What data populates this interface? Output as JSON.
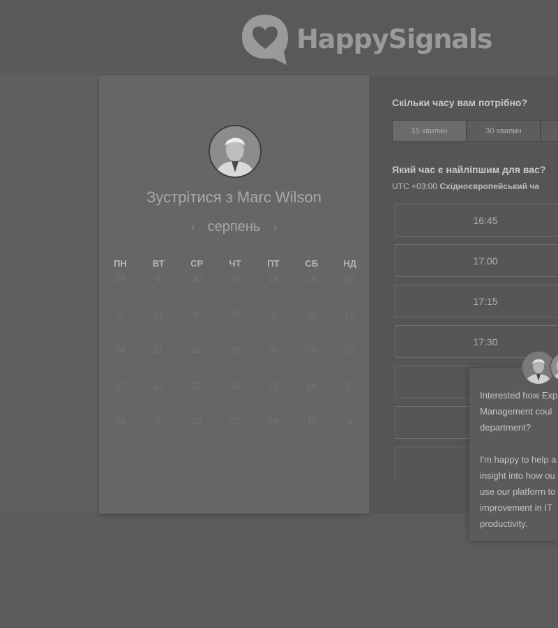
{
  "brand": {
    "name": "HappySignals",
    "logo_color": "#9a9a9a"
  },
  "left": {
    "title_prefix": "Зустрітися з",
    "host_name": "Marc Wilson",
    "month": "серпень",
    "prev_icon": "chevron-left-icon",
    "next_icon": "chevron-right-icon",
    "weekdays": [
      "ПН",
      "ВТ",
      "СР",
      "ЧТ",
      "ПТ",
      "СБ",
      "НД"
    ],
    "weeks": [
      [
        "29",
        "6",
        "30",
        "27",
        "14",
        "28",
        "24"
      ],
      [
        "5",
        "21",
        "4",
        "20",
        "6",
        "30",
        "19"
      ],
      [
        "24",
        "11",
        "21",
        "29",
        "26",
        "29",
        "13"
      ],
      [
        "27",
        "12",
        "21",
        "31",
        "13",
        "14",
        "17"
      ],
      [
        "18",
        "9",
        "22",
        "25",
        "29",
        "11",
        "4"
      ]
    ]
  },
  "right": {
    "duration_question": "Скільки часу вам потрібно?",
    "durations": [
      "15 хвилин",
      "30 хвилин",
      ""
    ],
    "time_question": "Який час є найліпшим для вас?",
    "tz_offset": "UTC +03:00",
    "tz_name": "Східноєвропейський ча",
    "slots": [
      "16:45",
      "17:00",
      "17:15",
      "17:30",
      "",
      "",
      "",
      ""
    ]
  },
  "chat": {
    "message": "Interested how Exp\nManagement coul\ndepartment?\n\nI'm happy to help a\ninsight into how ou\nuse our platform to\nimprovement in IT\nproductivity."
  }
}
